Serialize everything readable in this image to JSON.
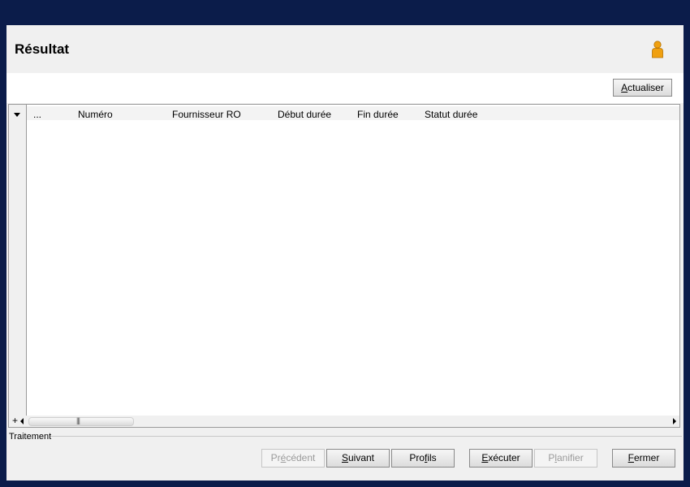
{
  "header": {
    "title": "Résultat",
    "user_icon": "user-icon"
  },
  "toolbar": {
    "refresh_label": "Actualiser",
    "refresh_accel": "A",
    "refresh_rest": "ctualiser"
  },
  "grid": {
    "columns": [
      "...",
      "Numéro",
      "Fournisseur RO",
      "Début durée",
      "Fin durée",
      "Statut durée"
    ],
    "rows": [],
    "add_label": "+",
    "scroll_grip": "|||"
  },
  "footer": {
    "group_label": "Traitement",
    "buttons": {
      "previous": {
        "pre": "Pr",
        "accel": "é",
        "post": "cédent",
        "enabled": false
      },
      "next": {
        "pre": "",
        "accel": "S",
        "post": "uivant",
        "enabled": true
      },
      "profiles": {
        "pre": "Pro",
        "accel": "f",
        "post": "ils",
        "enabled": true
      },
      "execute": {
        "pre": "",
        "accel": "E",
        "post": "xécuter",
        "enabled": true
      },
      "schedule": {
        "pre": "P",
        "accel": "l",
        "post": "anifier",
        "enabled": false
      },
      "close": {
        "pre": "",
        "accel": "F",
        "post": "ermer",
        "enabled": true
      }
    }
  },
  "colors": {
    "background": "#0b1c4a",
    "window": "#f0f0f0",
    "accent_user_icon": "#f0a010"
  }
}
